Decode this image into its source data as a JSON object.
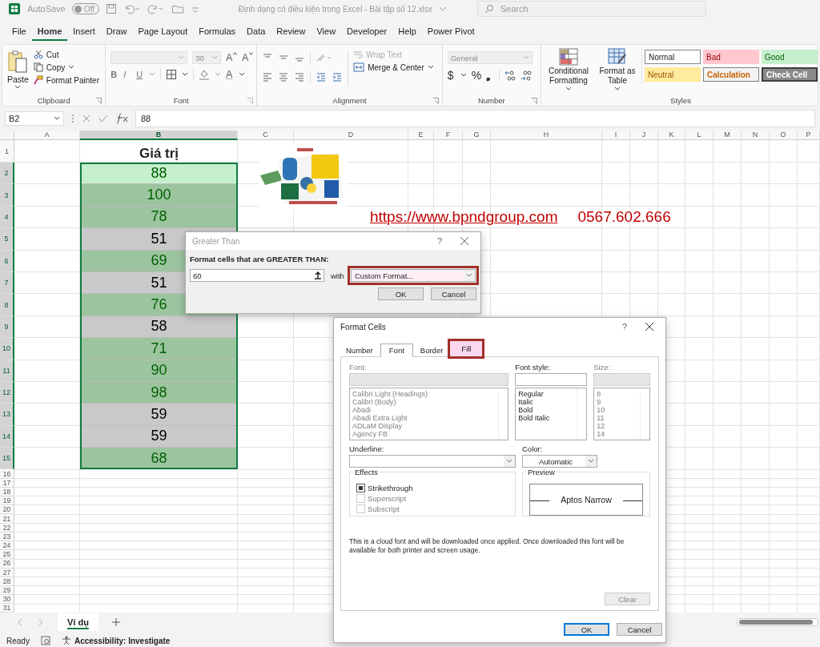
{
  "title_bar": {
    "autosave_label": "AutoSave",
    "autosave_on": false,
    "autosave_state": "Off",
    "document_title": "Định dạng có điều kiện trong Excel  -  Bài tập số 12.xlsx",
    "search": {
      "placeholder": "Search"
    }
  },
  "menu_tabs": [
    {
      "label": "File",
      "selected": false
    },
    {
      "label": "Home",
      "selected": true
    },
    {
      "label": "Insert",
      "selected": false
    },
    {
      "label": "Draw",
      "selected": false
    },
    {
      "label": "Page Layout",
      "selected": false
    },
    {
      "label": "Formulas",
      "selected": false
    },
    {
      "label": "Data",
      "selected": false
    },
    {
      "label": "Review",
      "selected": false
    },
    {
      "label": "View",
      "selected": false
    },
    {
      "label": "Developer",
      "selected": false
    },
    {
      "label": "Help",
      "selected": false
    },
    {
      "label": "Power Pivot",
      "selected": false
    }
  ],
  "clipboard": {
    "paste": "Paste",
    "cut": "Cut",
    "copy": "Copy",
    "format_painter": "Format Painter",
    "label": "Clipboard"
  },
  "font_group": {
    "font_size": "30",
    "grow": "A",
    "shrink": "A",
    "buttons": [
      {
        "label": "B",
        "kind": "bold"
      },
      {
        "label": "I",
        "kind": "italic"
      },
      {
        "label": "U",
        "kind": "underline"
      }
    ],
    "font_color": "A",
    "label": "Font"
  },
  "alignment": {
    "wrap_text": "Wrap Text",
    "merge_center": "Merge & Center",
    "label": "Alignment"
  },
  "number": {
    "format": "General",
    "currency": "$",
    "percent": "%",
    "comma": "❟",
    "label": "Number"
  },
  "styles": {
    "conditional_formatting": "Conditional Formatting",
    "format_as_table": "Format as Table",
    "label": "Styles",
    "cell_styles": [
      {
        "label": "Normal",
        "kind": "normal"
      },
      {
        "label": "Bad",
        "kind": "bad"
      },
      {
        "label": "Good",
        "kind": "good"
      },
      {
        "label": "Neutral",
        "kind": "neutral"
      },
      {
        "label": "Calculation",
        "kind": "calculation"
      },
      {
        "label": "Check Cell",
        "kind": "check"
      }
    ]
  },
  "formula_bar": {
    "name_box": "B2",
    "value": "88"
  },
  "sheet": {
    "columns": [
      {
        "label": "A",
        "selected": false
      },
      {
        "label": "B",
        "selected": true
      },
      {
        "label": "C",
        "selected": false
      },
      {
        "label": "D",
        "selected": false
      },
      {
        "label": "E",
        "selected": false
      },
      {
        "label": "F",
        "selected": false
      },
      {
        "label": "G",
        "selected": false
      },
      {
        "label": "H",
        "selected": false
      },
      {
        "label": "I",
        "selected": false
      },
      {
        "label": "J",
        "selected": false
      },
      {
        "label": "K",
        "selected": false
      },
      {
        "label": "L",
        "selected": false
      },
      {
        "label": "M",
        "selected": false
      },
      {
        "label": "N",
        "selected": false
      },
      {
        "label": "O",
        "selected": false
      },
      {
        "label": "P",
        "selected": false
      }
    ],
    "rows": [
      {
        "label": "1",
        "selected": false
      },
      {
        "label": "2",
        "selected": true
      },
      {
        "label": "3",
        "selected": true
      },
      {
        "label": "4",
        "selected": true
      },
      {
        "label": "5",
        "selected": true
      },
      {
        "label": "6",
        "selected": true
      },
      {
        "label": "7",
        "selected": true
      },
      {
        "label": "8",
        "selected": true
      },
      {
        "label": "9",
        "selected": true
      },
      {
        "label": "10",
        "selected": true
      },
      {
        "label": "11",
        "selected": true
      },
      {
        "label": "12",
        "selected": true
      },
      {
        "label": "13",
        "selected": true
      },
      {
        "label": "14",
        "selected": true
      },
      {
        "label": "15",
        "selected": true
      },
      {
        "label": "16",
        "selected": false
      },
      {
        "label": "17",
        "selected": false
      },
      {
        "label": "18",
        "selected": false
      },
      {
        "label": "19",
        "selected": false
      },
      {
        "label": "20",
        "selected": false
      },
      {
        "label": "21",
        "selected": false
      },
      {
        "label": "22",
        "selected": false
      },
      {
        "label": "23",
        "selected": false
      },
      {
        "label": "24",
        "selected": false
      },
      {
        "label": "25",
        "selected": false
      },
      {
        "label": "26",
        "selected": false
      },
      {
        "label": "27",
        "selected": false
      },
      {
        "label": "28",
        "selected": false
      },
      {
        "label": "29",
        "selected": false
      },
      {
        "label": "30",
        "selected": false
      },
      {
        "label": "31",
        "selected": false
      }
    ],
    "header": "Giá trị",
    "values": [
      {
        "value": "88",
        "highlighted": true,
        "active": true
      },
      {
        "value": "100",
        "highlighted": true,
        "active": false
      },
      {
        "value": "78",
        "highlighted": true,
        "active": false
      },
      {
        "value": "51",
        "highlighted": false,
        "active": false
      },
      {
        "value": "69",
        "highlighted": true,
        "active": false
      },
      {
        "value": "51",
        "highlighted": false,
        "active": false
      },
      {
        "value": "76",
        "highlighted": true,
        "active": false
      },
      {
        "value": "58",
        "highlighted": false,
        "active": false
      },
      {
        "value": "71",
        "highlighted": true,
        "active": false
      },
      {
        "value": "90",
        "highlighted": true,
        "active": false
      },
      {
        "value": "98",
        "highlighted": true,
        "active": false
      },
      {
        "value": "59",
        "highlighted": false,
        "active": false
      },
      {
        "value": "59",
        "highlighted": false,
        "active": false
      },
      {
        "value": "68",
        "highlighted": true,
        "active": false
      }
    ],
    "link": "https://www.bpndgroup.com",
    "phone": "0567.602.666"
  },
  "greater_than_dialog": {
    "title": "Greater Than",
    "help": "?",
    "prompt": "Format cells that are GREATER THAN:",
    "value": "60",
    "with_label": "with",
    "format": {
      "value": "Custom Format...",
      "highlighted": true
    },
    "buttons": [
      "OK",
      "Cancel"
    ]
  },
  "format_cells_dialog": {
    "title": "Format Cells",
    "help": "?",
    "tabs": [
      {
        "label": "Number",
        "selected": false,
        "highlighted": false
      },
      {
        "label": "Font",
        "selected": true,
        "highlighted": false
      },
      {
        "label": "Border",
        "selected": false,
        "highlighted": false
      },
      {
        "label": "Fill",
        "selected": false,
        "highlighted": true
      }
    ],
    "font": {
      "label": "Font:",
      "disabled": true,
      "items": [
        "Calibri Light (Headings)",
        "Calibri (Body)",
        "Abadi",
        "Abadi Extra Light",
        "ADLaM Display",
        "Agency FB"
      ]
    },
    "font_style": {
      "label": "Font style:",
      "disabled": false,
      "items": [
        "Regular",
        "Italic",
        "Bold",
        "Bold Italic"
      ]
    },
    "size": {
      "label": "Size:",
      "disabled": true,
      "items": [
        "8",
        "9",
        "10",
        "11",
        "12",
        "14"
      ]
    },
    "underline": {
      "label": "Underline:"
    },
    "color": {
      "label": "Color:",
      "value": "Automatic"
    },
    "effects": {
      "label": "Effects",
      "items": [
        {
          "label": "Strikethrough",
          "checked": true,
          "disabled": false
        },
        {
          "label": "Superscript",
          "checked": false,
          "disabled": true
        },
        {
          "label": "Subscript",
          "checked": false,
          "disabled": true
        }
      ]
    },
    "preview": {
      "label": "Preview",
      "sample": "Aptos Narrow"
    },
    "note": "This is a cloud font and will be downloaded once applied. Once downloaded this font will be available for both printer and screen usage.",
    "clear": {
      "label": "Clear",
      "disabled": true
    },
    "buttons": [
      {
        "label": "OK",
        "default": true
      },
      {
        "label": "Cancel",
        "default": false
      }
    ]
  },
  "sheet_tabs": [
    {
      "label": "Ví dụ",
      "selected": true
    }
  ],
  "status_bar": {
    "ready": "Ready",
    "accessibility": "Accessibility: Investigate"
  }
}
